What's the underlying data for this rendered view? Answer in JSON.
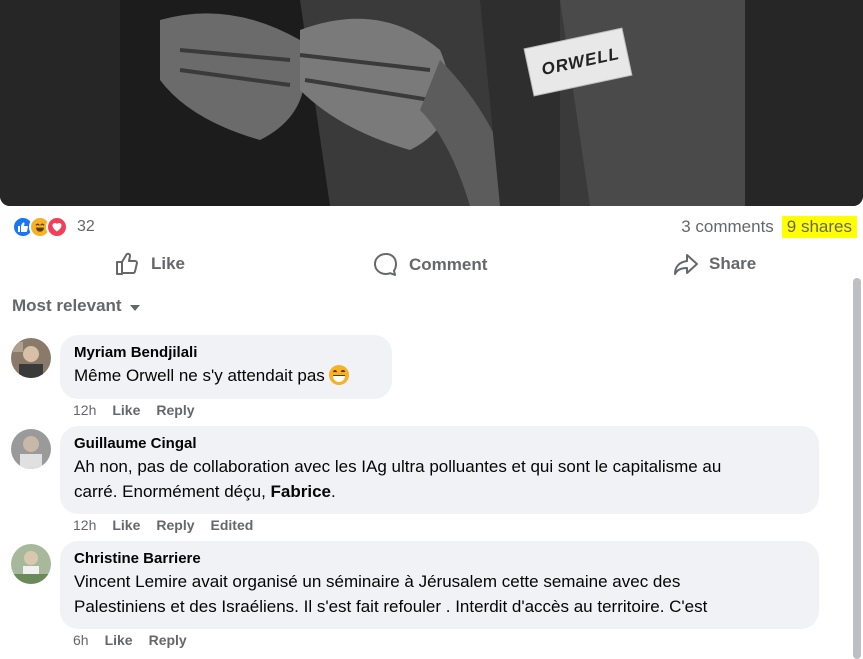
{
  "post": {
    "image_label": "ORWELL",
    "reaction_icons": [
      "like-reaction-icon",
      "haha-reaction-icon",
      "love-reaction-icon"
    ],
    "reaction_count": "32",
    "comments_count": "3 comments",
    "shares_count": "9 shares"
  },
  "actions": {
    "like": "Like",
    "comment": "Comment",
    "share": "Share"
  },
  "sort": {
    "label": "Most relevant"
  },
  "comments": [
    {
      "author": "Myriam Bendjilali",
      "text": "Même Orwell ne s'y attendait pas",
      "emoji": "grinning-emoji",
      "time": "12h",
      "like": "Like",
      "reply": "Reply"
    },
    {
      "author": "Guillaume Cingal",
      "text_line1": "Ah non, pas de collaboration avec les IAg ultra polluantes et qui sont le capitalisme au",
      "text_line2": "carré. Enormément déçu, ",
      "mention": "Fabrice",
      "text_end": ".",
      "time": "12h",
      "like": "Like",
      "reply": "Reply",
      "edited": "Edited"
    },
    {
      "author": "Christine Barriere",
      "text_line1": "Vincent Lemire avait organisé un séminaire à Jérusalem cette semaine avec des",
      "text_line2": "Palestiniens et des Israéliens. Il s'est fait refouler . Interdit d'accès au territoire. C'est",
      "time": "6h",
      "like": "Like",
      "reply": "Reply"
    }
  ],
  "colors": {
    "accent": "#1877f2",
    "secondary_text": "#65676b",
    "bubble": "#f0f2f5",
    "highlight": "#ffff00"
  }
}
